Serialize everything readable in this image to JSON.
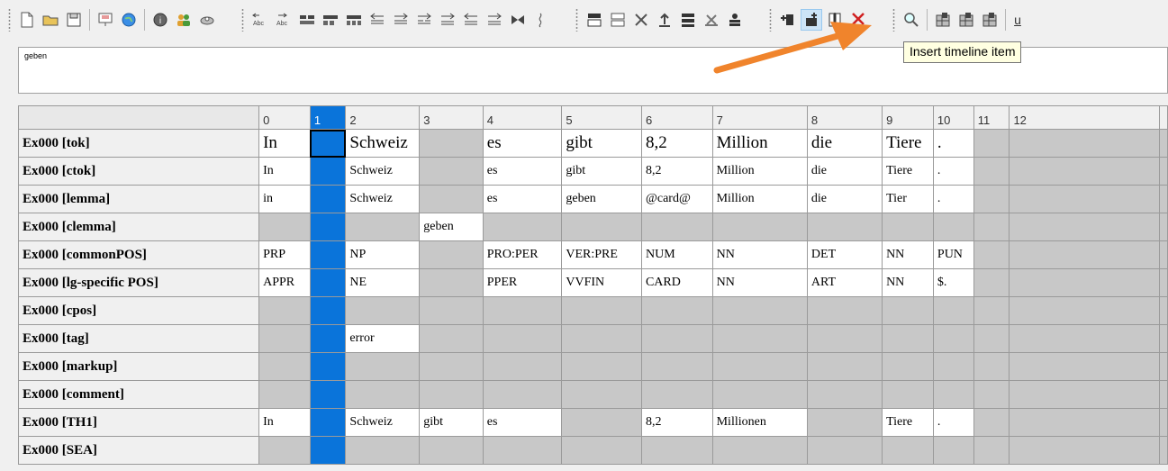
{
  "editor": {
    "text": "geben"
  },
  "tooltip": {
    "text": "Insert timeline item"
  },
  "toolbar": {
    "file_icons": [
      "new-document-icon",
      "open-folder-icon",
      "save-icon",
      "presentation-icon",
      "globe-icon",
      "info-icon",
      "users-icon",
      "search-disk-icon"
    ],
    "timeline_icons": [
      "split-left-icon",
      "split-right-icon",
      "merge-1-icon",
      "merge-2-icon",
      "merge-3-icon",
      "shift-left-1-icon",
      "shift-right-1-icon",
      "shift-right-2-icon",
      "shift-right-3-icon",
      "shift-left-2-icon",
      "shift-right-4-icon",
      "bowtie-icon",
      "squiggle-icon"
    ],
    "tier_icons": [
      "tier-up-icon",
      "tier-down-icon",
      "tier-remove-icon",
      "tier-top-icon",
      "tier-type-icon",
      "tier-clear-icon",
      "tier-speaker-icon"
    ],
    "insert_icons": [
      "insert-timeline-item-icon",
      "insert-timeline-item-active-icon",
      "split-column-icon",
      "delete-timeline-item-icon"
    ],
    "view_icons": [
      "find-icon",
      "grid-view-1-icon",
      "grid-view-2-icon",
      "grid-view-3-icon"
    ],
    "underline_label": "u"
  },
  "colors": {
    "selected_column": "#0a74da",
    "arrow": "#f0842c",
    "tooltip_bg": "#ffffe1"
  },
  "grid": {
    "columns": [
      "0",
      "1",
      "2",
      "3",
      "4",
      "5",
      "6",
      "7",
      "8",
      "9",
      "10",
      "11",
      "12"
    ],
    "selected_column": 1,
    "rows": [
      {
        "label": "Ex000 [tok]",
        "cells": [
          "In",
          "",
          "Schweiz",
          "",
          "es",
          "gibt",
          "8,2",
          "Million",
          "die",
          "Tiere",
          ".",
          "",
          ""
        ],
        "white": [
          0,
          2,
          4,
          5,
          6,
          7,
          8,
          9,
          10
        ]
      },
      {
        "label": "Ex000 [ctok]",
        "cells": [
          "In",
          "",
          "Schweiz",
          "",
          "es",
          "gibt",
          "8,2",
          "Million",
          "die",
          "Tiere",
          ".",
          "",
          ""
        ],
        "white": [
          0,
          2,
          4,
          5,
          6,
          7,
          8,
          9,
          10
        ]
      },
      {
        "label": "Ex000 [lemma]",
        "cells": [
          "in",
          "",
          "Schweiz",
          "",
          "es",
          "geben",
          "@card@",
          "Million",
          "die",
          "Tier",
          ".",
          "",
          ""
        ],
        "white": [
          0,
          2,
          4,
          5,
          6,
          7,
          8,
          9,
          10
        ]
      },
      {
        "label": "Ex000 [clemma]",
        "cells": [
          "",
          "",
          "",
          "geben",
          "",
          "",
          "",
          "",
          "",
          "",
          "",
          "",
          ""
        ],
        "white": [
          3
        ]
      },
      {
        "label": "Ex000 [commonPOS]",
        "cells": [
          "PRP",
          "",
          "NP",
          "",
          "PRO:PER",
          "VER:PRE",
          "NUM",
          "NN",
          "DET",
          "NN",
          "PUN",
          "",
          ""
        ],
        "white": [
          0,
          2,
          4,
          5,
          6,
          7,
          8,
          9,
          10
        ]
      },
      {
        "label": "Ex000 [lg-specific POS]",
        "cells": [
          "APPR",
          "",
          "NE",
          "",
          "PPER",
          "VVFIN",
          "CARD",
          "NN",
          "ART",
          "NN",
          "$.",
          "",
          ""
        ],
        "white": [
          0,
          2,
          4,
          5,
          6,
          7,
          8,
          9,
          10
        ]
      },
      {
        "label": "Ex000 [cpos]",
        "cells": [
          "",
          "",
          "",
          "",
          "",
          "",
          "",
          "",
          "",
          "",
          "",
          "",
          ""
        ],
        "white": []
      },
      {
        "label": "Ex000 [tag]",
        "cells": [
          "",
          "",
          "error",
          "",
          "",
          "",
          "",
          "",
          "",
          "",
          "",
          "",
          ""
        ],
        "white": [
          2
        ]
      },
      {
        "label": "Ex000 [markup]",
        "cells": [
          "",
          "",
          "",
          "",
          "",
          "",
          "",
          "",
          "",
          "",
          "",
          "",
          ""
        ],
        "white": []
      },
      {
        "label": "Ex000 [comment]",
        "cells": [
          "",
          "",
          "",
          "",
          "",
          "",
          "",
          "",
          "",
          "",
          "",
          "",
          ""
        ],
        "white": []
      },
      {
        "label": "Ex000 [TH1]",
        "cells": [
          "In",
          "",
          "Schweiz",
          "gibt",
          "es",
          "",
          "8,2",
          "Millionen",
          "",
          "Tiere",
          ".",
          "",
          ""
        ],
        "white": [
          0,
          2,
          3,
          4,
          6,
          7,
          9,
          10
        ]
      },
      {
        "label": "Ex000 [SEA]",
        "cells": [
          "",
          "",
          "",
          "",
          "",
          "",
          "",
          "",
          "",
          "",
          "",
          "",
          ""
        ],
        "white": []
      }
    ]
  }
}
